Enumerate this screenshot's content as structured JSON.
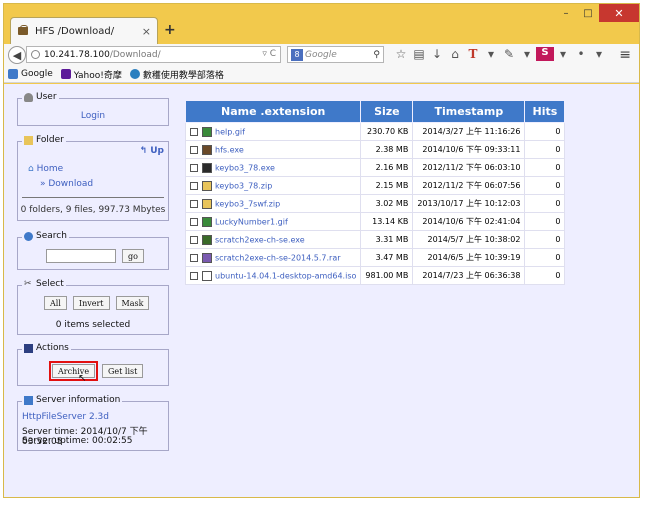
{
  "browser": {
    "tab_title": "HFS /Download/",
    "tab_close": "×",
    "new_tab": "+",
    "window_buttons": {
      "minimize": "–",
      "maximize": "□",
      "close": "✕"
    },
    "url_host": "10.241.78.100",
    "url_path": "/Download/",
    "url_tail": "▿ C",
    "search_placeholder": "Google",
    "bookmarks": [
      {
        "label": "Google",
        "icon": "google-icon",
        "color": "#3f79c9"
      },
      {
        "label": "Yahoo!奇摩",
        "icon": "yahoo-icon",
        "color": "#5c1a99"
      },
      {
        "label": "數穫使用教學部落格",
        "icon": "blog-icon",
        "color": "#2a7fbf"
      }
    ],
    "toolbar_text": "T"
  },
  "sidebar": {
    "user": {
      "title": "User",
      "login": "Login"
    },
    "folder": {
      "title": "Folder",
      "up": "Up",
      "home": "Home",
      "current": "» Download",
      "stats": "0 folders, 9 files, 997.73 Mbytes"
    },
    "search": {
      "title": "Search",
      "input_value": "",
      "go": "go"
    },
    "select": {
      "title": "Select",
      "all": "All",
      "invert": "Invert",
      "mask": "Mask",
      "selected": "0 items selected"
    },
    "actions": {
      "title": "Actions",
      "archive": "Archive",
      "get_list": "Get list"
    },
    "server": {
      "title": "Server information",
      "link": "HttpFileServer 2.3d",
      "time": "Server time: 2014/10/7 下午 03:52:05",
      "uptime": "Server uptime: 00:02:55"
    }
  },
  "table": {
    "headers": [
      "Name .extension",
      "Size",
      "Timestamp",
      "Hits"
    ],
    "rows": [
      {
        "name": "help.gif",
        "icon": "gif-icon",
        "size": "230.70 KB",
        "timestamp": "2014/3/27 上午 11:16:26",
        "hits": "0"
      },
      {
        "name": "hfs.exe",
        "icon": "exe-icon",
        "size": "2.38 MB",
        "timestamp": "2014/10/6 下午 09:33:11",
        "hits": "0"
      },
      {
        "name": "keybo3_78.exe",
        "icon": "exe-icon",
        "size": "2.16 MB",
        "timestamp": "2012/11/2 下午 06:03:10",
        "hits": "0"
      },
      {
        "name": "keybo3_78.zip",
        "icon": "zip-icon",
        "size": "2.15 MB",
        "timestamp": "2012/11/2 下午 06:07:56",
        "hits": "0"
      },
      {
        "name": "keybo3_7swf.zip",
        "icon": "zip-icon",
        "size": "3.02 MB",
        "timestamp": "2013/10/17 上午 10:12:03",
        "hits": "0"
      },
      {
        "name": "LuckyNumber1.gif",
        "icon": "gif-icon",
        "size": "13.14 KB",
        "timestamp": "2014/10/6 下午 02:41:04",
        "hits": "0"
      },
      {
        "name": "scratch2exe-ch-se.exe",
        "icon": "exe-icon",
        "size": "3.31 MB",
        "timestamp": "2014/5/7 上午 10:38:02",
        "hits": "0"
      },
      {
        "name": "scratch2exe-ch-se-2014.5.7.rar",
        "icon": "rar-icon",
        "size": "3.47 MB",
        "timestamp": "2014/6/5 上午 10:39:19",
        "hits": "0"
      },
      {
        "name": "ubuntu-14.04.1-desktop-amd64.iso",
        "icon": "iso-icon",
        "size": "981.00 MB",
        "timestamp": "2014/7/23 上午 06:36:38",
        "hits": "0"
      }
    ]
  },
  "colors": {
    "header_bg": "#3f79c9",
    "content_bg": "#eeeeff",
    "link": "#3f60c0",
    "titlebar": "#f2c94c",
    "highlight": "#e21010"
  }
}
